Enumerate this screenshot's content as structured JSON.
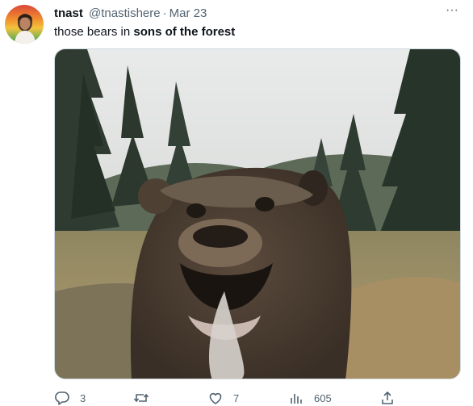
{
  "tweet": {
    "display_name": "tnast",
    "handle": "@tnastishere",
    "separator": "·",
    "date": "Mar 23",
    "more_icon": "more-horizontal-icon",
    "text_plain": "those bears in ",
    "text_bold": "sons of the forest",
    "media": {
      "type": "video-still",
      "subject": "bear-close-up"
    }
  },
  "actions": {
    "reply": {
      "icon": "reply-icon",
      "count": "3"
    },
    "retweet": {
      "icon": "retweet-icon",
      "count": ""
    },
    "like": {
      "icon": "heart-icon",
      "count": "7"
    },
    "views": {
      "icon": "views-chart-icon",
      "count": "605"
    },
    "share": {
      "icon": "share-icon"
    }
  },
  "colors": {
    "text_primary": "#0f1419",
    "text_secondary": "#536471",
    "border": "#cfd9de"
  }
}
